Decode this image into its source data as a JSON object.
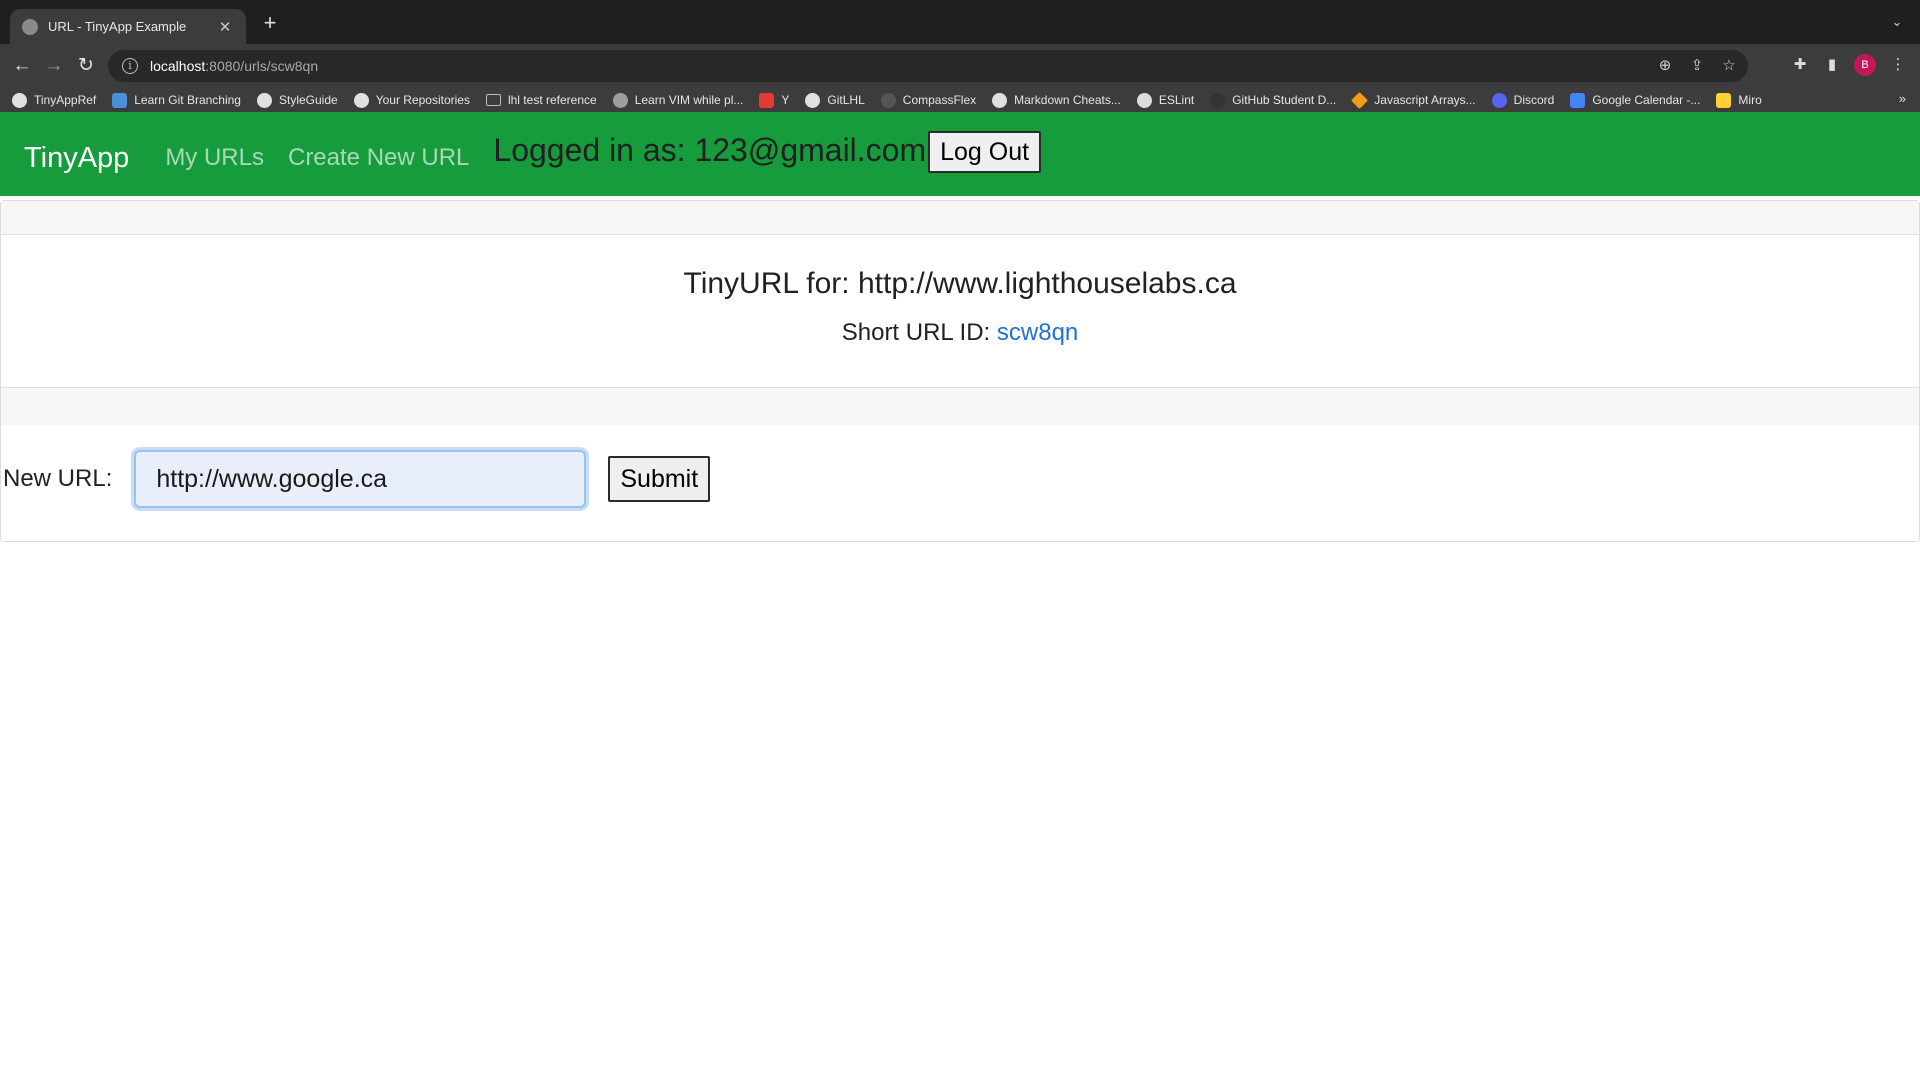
{
  "browser": {
    "tab": {
      "title": "URL - TinyApp Example"
    },
    "address": {
      "host": "localhost",
      "path": ":8080/urls/scw8qn"
    },
    "bookmarks": [
      {
        "label": "TinyAppRef",
        "icon": "github-icon",
        "color": "#e0e0e0"
      },
      {
        "label": "Learn Git Branching",
        "icon": "learn-git-icon",
        "color": "#4a90d9"
      },
      {
        "label": "StyleGuide",
        "icon": "github-icon",
        "color": "#e0e0e0"
      },
      {
        "label": "Your Repositories",
        "icon": "github-icon",
        "color": "#e0e0e0"
      },
      {
        "label": "lhl test reference",
        "icon": "folder-icon",
        "color": "#bdbdbd"
      },
      {
        "label": "Learn VIM while pl...",
        "icon": "globe-icon",
        "color": "#9e9e9e"
      },
      {
        "label": "Y",
        "icon": "youtube-icon",
        "color": "#e53935"
      },
      {
        "label": "GitLHL",
        "icon": "github-icon",
        "color": "#e0e0e0"
      },
      {
        "label": "CompassFlex",
        "icon": "compass-icon",
        "color": "#555555"
      },
      {
        "label": "Markdown Cheats...",
        "icon": "github-icon",
        "color": "#e0e0e0"
      },
      {
        "label": "ESLint",
        "icon": "eslint-icon",
        "color": "#dddddd"
      },
      {
        "label": "GitHub Student D...",
        "icon": "github-icon",
        "color": "#333333"
      },
      {
        "label": "Javascript Arrays...",
        "icon": "diamond-icon",
        "color": "#f39c12"
      },
      {
        "label": "Discord",
        "icon": "discord-icon",
        "color": "#5865f2"
      },
      {
        "label": "Google Calendar -...",
        "icon": "calendar-icon",
        "color": "#4285f4"
      },
      {
        "label": "Miro",
        "icon": "miro-icon",
        "color": "#ffd02f"
      }
    ],
    "profile_initial": "B"
  },
  "navbar": {
    "brand": "TinyApp",
    "links": [
      "My URLs",
      "Create New URL"
    ],
    "logged_in_text": "Logged in as: 123@gmail.com",
    "logout_label": "Log Out"
  },
  "card": {
    "title": "TinyURL for: http://www.lighthouselabs.ca",
    "short_url_label": "Short URL ID: ",
    "short_url_id": "scw8qn",
    "form": {
      "label": "New URL:",
      "value": "http://www.google.ca",
      "submit_label": "Submit"
    }
  },
  "colors": {
    "navbar_bg": "#169c3d",
    "link": "#1f72d4"
  }
}
